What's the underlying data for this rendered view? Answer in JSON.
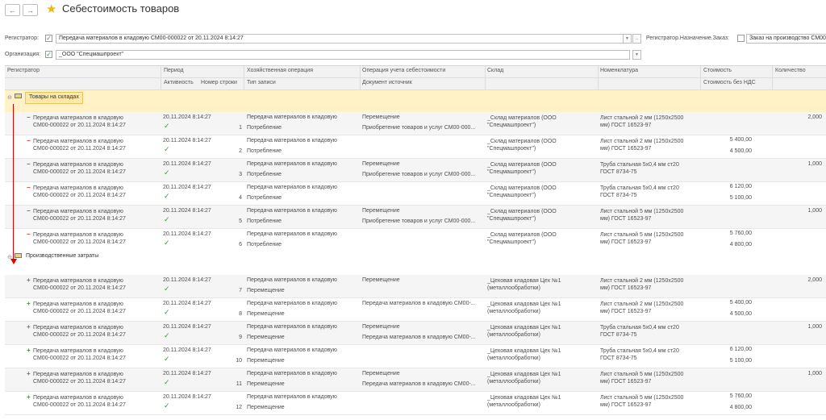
{
  "header": {
    "title": "Себестоимость товаров",
    "back_glyph": "←",
    "forward_glyph": "→"
  },
  "filters": {
    "registrator_label": "Регистратор:",
    "registrator_value": "Передача материалов в кладовую СМ00-000022 от 20.11.2024 8:14:27",
    "dest_label": "Регистратор.Назначение.Заказ:",
    "dest_value": "Заказ на производство СМ00",
    "org_label": "Организация:",
    "org_value": "_ООО \"Спецмашпроект\"",
    "dots_label": "..."
  },
  "columns": {
    "registrator": "Регистратор",
    "period": "Период",
    "activity": "Активность",
    "line_number": "Номер строки",
    "business_op": "Хозяйственная операция",
    "record_type": "Тип записи",
    "cost_op": "Операция учета себестоимости",
    "source_doc": "Документ источник",
    "warehouse": "Склад",
    "nomenclature": "Номенклатура",
    "cost": "Стоимость",
    "cost_no_vat": "Стоимость без НДС",
    "quantity": "Количество"
  },
  "groups": [
    {
      "label": "Товары на складах",
      "rows": [
        {
          "mark": "−",
          "reg1": "Передача материалов в кладовую",
          "reg2": "СМ00-000022 от 20.11.2024 8:14:27",
          "period": "20.11.2024 8:14:27",
          "num": "1",
          "hop": "Передача материалов в кладовую",
          "typ": "Потребление",
          "ops": "Перемещение",
          "doc": "Приобретение товаров и услуг СМ00-000...",
          "skl1": "_Склад материалов (ООО",
          "skl2": "\"Спецмашпроект\")",
          "nom1": "Лист стальной 2 мм (1250х2500",
          "nom2": "мм) ГОСТ 16523-97",
          "st": "",
          "stn": "",
          "qty": "2,000"
        },
        {
          "mark": "−",
          "reg1": "Передача материалов в кладовую",
          "reg2": "СМ00-000022 от 20.11.2024 8:14:27",
          "period": "20.11.2024 8:14:27",
          "num": "2",
          "hop": "Передача материалов в кладовую",
          "typ": "Потребление",
          "ops": "",
          "doc": "",
          "skl1": "_Склад материалов (ООО",
          "skl2": "\"Спецмашпроект\")",
          "nom1": "Лист стальной 2 мм (1250х2500",
          "nom2": "мм) ГОСТ 16523-97",
          "st": "5 400,00",
          "stn": "4 500,00",
          "qty": ""
        },
        {
          "mark": "−",
          "reg1": "Передача материалов в кладовую",
          "reg2": "СМ00-000022 от 20.11.2024 8:14:27",
          "period": "20.11.2024 8:14:27",
          "num": "3",
          "hop": "Передача материалов в кладовую",
          "typ": "Потребление",
          "ops": "Перемещение",
          "doc": "Приобретение товаров и услуг СМ00-000...",
          "skl1": "_Склад материалов (ООО",
          "skl2": "\"Спецмашпроект\")",
          "nom1": "Труба стальная 5х0,4 мм ст20",
          "nom2": "ГОСТ 8734-75",
          "st": "",
          "stn": "",
          "qty": "1,000"
        },
        {
          "mark": "−",
          "reg1": "Передача материалов в кладовую",
          "reg2": "СМ00-000022 от 20.11.2024 8:14:27",
          "period": "20.11.2024 8:14:27",
          "num": "4",
          "hop": "Передача материалов в кладовую",
          "typ": "Потребление",
          "ops": "",
          "doc": "",
          "skl1": "_Склад материалов (ООО",
          "skl2": "\"Спецмашпроект\")",
          "nom1": "Труба стальная 5х0,4 мм ст20",
          "nom2": "ГОСТ 8734-75",
          "st": "6 120,00",
          "stn": "5 100,00",
          "qty": ""
        },
        {
          "mark": "−",
          "reg1": "Передача материалов в кладовую",
          "reg2": "СМ00-000022 от 20.11.2024 8:14:27",
          "period": "20.11.2024 8:14:27",
          "num": "5",
          "hop": "Передача материалов в кладовую",
          "typ": "Потребление",
          "ops": "Перемещение",
          "doc": "Приобретение товаров и услуг СМ00-000...",
          "skl1": "_Склад материалов (ООО",
          "skl2": "\"Спецмашпроект\")",
          "nom1": "Лист стальной 5 мм (1250х2500",
          "nom2": "мм) ГОСТ 16523-97",
          "st": "",
          "stn": "",
          "qty": "1,000"
        },
        {
          "mark": "−",
          "reg1": "Передача материалов в кладовую",
          "reg2": "СМ00-000022 от 20.11.2024 8:14:27",
          "period": "20.11.2024 8:14:27",
          "num": "6",
          "hop": "Передача материалов в кладовую",
          "typ": "Потребление",
          "ops": "",
          "doc": "",
          "skl1": "_Склад материалов (ООО",
          "skl2": "\"Спецмашпроект\")",
          "nom1": "Лист стальной 5 мм (1250х2500",
          "nom2": "мм) ГОСТ 16523-97",
          "st": "5 760,00",
          "stn": "4 800,00",
          "qty": ""
        }
      ]
    },
    {
      "label": "Производственные затраты",
      "rows": [
        {
          "mark": "+",
          "reg1": "Передача материалов в кладовую",
          "reg2": "СМ00-000022 от 20.11.2024 8:14:27",
          "period": "20.11.2024 8:14:27",
          "num": "7",
          "hop": "Передача материалов в кладовую",
          "typ": "Перемещение",
          "ops": "Перемещение",
          "doc": "",
          "skl1": "_Цеховая кладовая Цех №1",
          "skl2": "(металлообработки)",
          "nom1": "Лист стальной 2 мм (1250х2500",
          "nom2": "мм) ГОСТ 16523-97",
          "st": "",
          "stn": "",
          "qty": "2,000"
        },
        {
          "mark": "+",
          "reg1": "Передача материалов в кладовую",
          "reg2": "СМ00-000022 от 20.11.2024 8:14:27",
          "period": "20.11.2024 8:14:27",
          "num": "8",
          "hop": "Передача материалов в кладовую",
          "typ": "Перемещение",
          "ops": "Передача материалов в кладовую СМ00-...",
          "doc": "",
          "skl1": "_Цеховая кладовая Цех №1",
          "skl2": "(металлообработки)",
          "nom1": "Лист стальной 2 мм (1250х2500",
          "nom2": "мм) ГОСТ 16523-97",
          "st": "5 400,00",
          "stn": "4 500,00",
          "qty": ""
        },
        {
          "mark": "+",
          "reg1": "Передача материалов в кладовую",
          "reg2": "СМ00-000022 от 20.11.2024 8:14:27",
          "period": "20.11.2024 8:14:27",
          "num": "9",
          "hop": "Передача материалов в кладовую",
          "typ": "Перемещение",
          "ops": "Перемещение",
          "doc": "Передача материалов в кладовую СМ00-...",
          "skl1": "_Цеховая кладовая Цех №1",
          "skl2": "(металлообработки)",
          "nom1": "Труба стальная 5х0,4 мм ст20",
          "nom2": "ГОСТ 8734-75",
          "st": "",
          "stn": "",
          "qty": "1,000"
        },
        {
          "mark": "+",
          "reg1": "Передача материалов в кладовую",
          "reg2": "СМ00-000022 от 20.11.2024 8:14:27",
          "period": "20.11.2024 8:14:27",
          "num": "10",
          "hop": "Передача материалов в кладовую",
          "typ": "Перемещение",
          "ops": "",
          "doc": "",
          "skl1": "_Цеховая кладовая Цех №1",
          "skl2": "(металлообработки)",
          "nom1": "Труба стальная 5х0,4 мм ст20",
          "nom2": "ГОСТ 8734-75",
          "st": "6 120,00",
          "stn": "5 100,00",
          "qty": ""
        },
        {
          "mark": "+",
          "reg1": "Передача материалов в кладовую",
          "reg2": "СМ00-000022 от 20.11.2024 8:14:27",
          "period": "20.11.2024 8:14:27",
          "num": "11",
          "hop": "Передача материалов в кладовую",
          "typ": "Перемещение",
          "ops": "Перемещение",
          "doc": "Передача материалов в кладовую СМ00-...",
          "skl1": "_Цеховая кладовая Цех №1",
          "skl2": "(металлообработки)",
          "nom1": "Лист стальной 5 мм (1250х2500",
          "nom2": "мм) ГОСТ 16523-97",
          "st": "",
          "stn": "",
          "qty": "1,000"
        },
        {
          "mark": "+",
          "reg1": "Передача материалов в кладовую",
          "reg2": "СМ00-000022 от 20.11.2024 8:14:27",
          "period": "20.11.2024 8:14:27",
          "num": "12",
          "hop": "Передача материалов в кладовую",
          "typ": "Перемещение",
          "ops": "",
          "doc": "",
          "skl1": "_Цеховая кладовая Цех №1",
          "skl2": "(металлообработки)",
          "nom1": "Лист стальной 5 мм (1250х2500",
          "nom2": "мм) ГОСТ 16523-97",
          "st": "5 760,00",
          "stn": "4 800,00",
          "qty": ""
        }
      ]
    }
  ],
  "colors": {
    "group_bg": "#fff2c6",
    "row_alt_bg": "#f5f5f5",
    "minus": "#d23c3c",
    "plus": "#3e9a3e",
    "check": "#3a9a3a",
    "arrow": "#e00000",
    "star": "#f2b705"
  },
  "icons": {
    "star": "star-icon",
    "check": "checkmark-icon",
    "group": "group-folder-icon"
  }
}
